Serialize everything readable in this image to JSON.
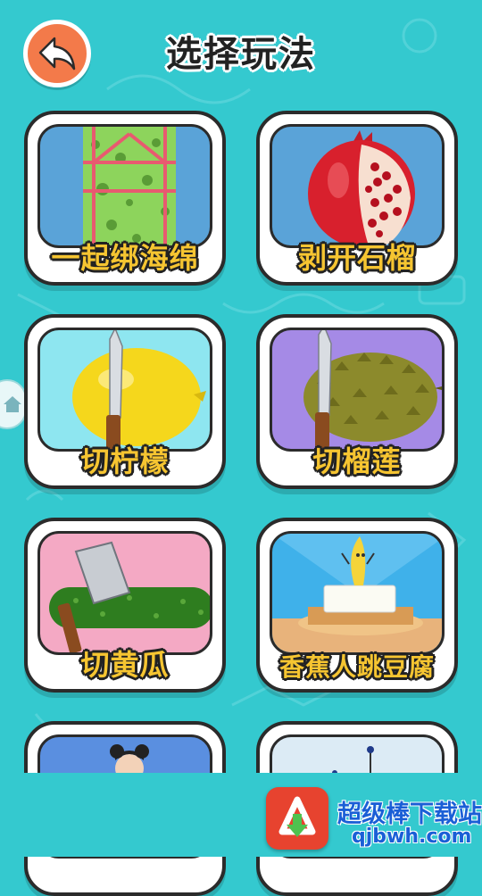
{
  "header": {
    "title": "选择玩法",
    "back_icon": "back-arrow-icon"
  },
  "colors": {
    "background": "#34c9cf",
    "label_fill": "#f6c531",
    "back_button": "#f37a4a"
  },
  "modes": [
    {
      "label": "一起绑海绵",
      "icon": "sponge-icon",
      "bg": "#5aa3d8"
    },
    {
      "label": "剥开石榴",
      "icon": "pomegranate-icon",
      "bg": "#5aa3d8"
    },
    {
      "label": "切柠檬",
      "icon": "lemon-knife-icon",
      "bg": "#8ee6f0"
    },
    {
      "label": "切榴莲",
      "icon": "durian-knife-icon",
      "bg": "#a58ae6"
    },
    {
      "label": "切黄瓜",
      "icon": "cucumber-cleaver-icon",
      "bg": "#f4a9c4"
    },
    {
      "label": "香蕉人跳豆腐",
      "icon": "banana-tofu-icon",
      "bg": "#3fb1ea"
    },
    {
      "label": "",
      "icon": "girl-avatar-icon",
      "bg": "#5a8fe0"
    },
    {
      "label": "",
      "icon": "string-puzzle-icon",
      "bg": "#dcebf5"
    }
  ],
  "watermark": {
    "name": "超级棒下载站",
    "url": "qjbwh.com",
    "icon": "download-logo-icon"
  },
  "side_tab": {
    "icon": "home-icon"
  }
}
